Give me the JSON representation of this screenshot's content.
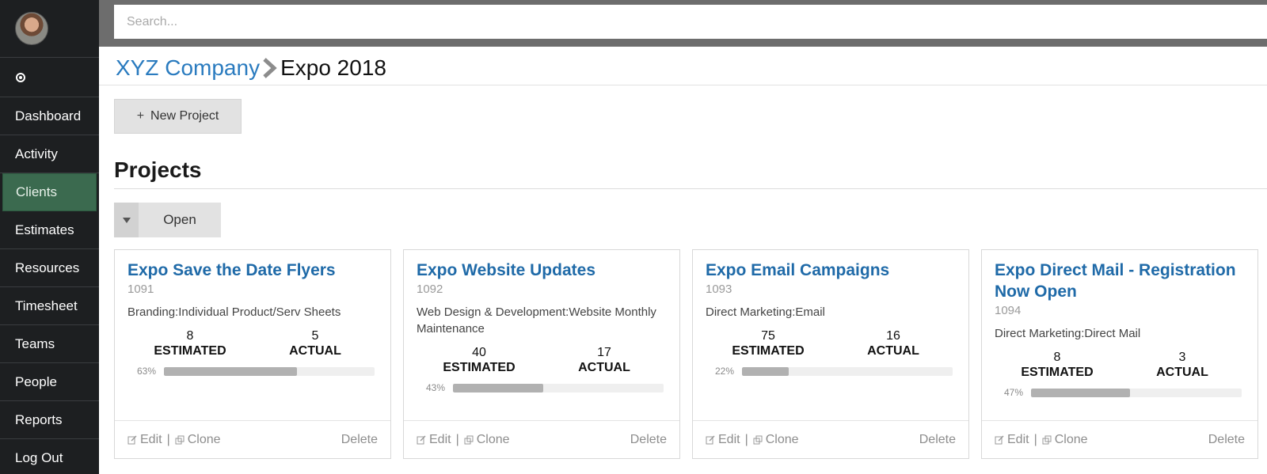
{
  "sidebar": {
    "items": [
      {
        "label": "Dashboard",
        "name": "dashboard"
      },
      {
        "label": "Activity",
        "name": "activity"
      },
      {
        "label": "Clients",
        "name": "clients",
        "active": true
      },
      {
        "label": "Estimates",
        "name": "estimates"
      },
      {
        "label": "Resources",
        "name": "resources"
      },
      {
        "label": "Timesheet",
        "name": "timesheet"
      },
      {
        "label": "Teams",
        "name": "teams"
      },
      {
        "label": "People",
        "name": "people"
      },
      {
        "label": "Reports",
        "name": "reports"
      },
      {
        "label": "Log Out",
        "name": "logout"
      }
    ]
  },
  "search": {
    "placeholder": "Search...",
    "value": ""
  },
  "breadcrumb": {
    "parent": "XYZ Company",
    "current": "Expo 2018"
  },
  "toolbar": {
    "new_project": "New Project"
  },
  "projects": {
    "title": "Projects",
    "filter": "Open",
    "cards": [
      {
        "title": "Expo Save the Date Flyers",
        "id": "1091",
        "category": "Branding:Individual Product/Serv Sheets",
        "estimated": "8",
        "actual": "5",
        "estimated_label": "ESTIMATED",
        "actual_label": "ACTUAL",
        "percent": "63%",
        "progress": 0.63,
        "edit": "Edit",
        "clone": "Clone",
        "delete": "Delete"
      },
      {
        "title": "Expo Website Updates",
        "id": "1092",
        "category": "Web Design & Development:Website Monthly Maintenance",
        "estimated": "40",
        "actual": "17",
        "estimated_label": "ESTIMATED",
        "actual_label": "ACTUAL",
        "percent": "43%",
        "progress": 0.43,
        "edit": "Edit",
        "clone": "Clone",
        "delete": "Delete"
      },
      {
        "title": "Expo Email Campaigns",
        "id": "1093",
        "category": "Direct Marketing:Email",
        "estimated": "75",
        "actual": "16",
        "estimated_label": "ESTIMATED",
        "actual_label": "ACTUAL",
        "percent": "22%",
        "progress": 0.22,
        "edit": "Edit",
        "clone": "Clone",
        "delete": "Delete"
      },
      {
        "title": "Expo Direct Mail - Registration Now Open",
        "id": "1094",
        "category": "Direct Marketing:Direct Mail",
        "estimated": "8",
        "actual": "3",
        "estimated_label": "ESTIMATED",
        "actual_label": "ACTUAL",
        "percent": "47%",
        "progress": 0.47,
        "edit": "Edit",
        "clone": "Clone",
        "delete": "Delete"
      }
    ]
  },
  "colors": {
    "link": "#2a7bbf",
    "card_title": "#1f6aa8",
    "active_nav": "#3b6a4f",
    "sidebar": "#1d1f21"
  }
}
